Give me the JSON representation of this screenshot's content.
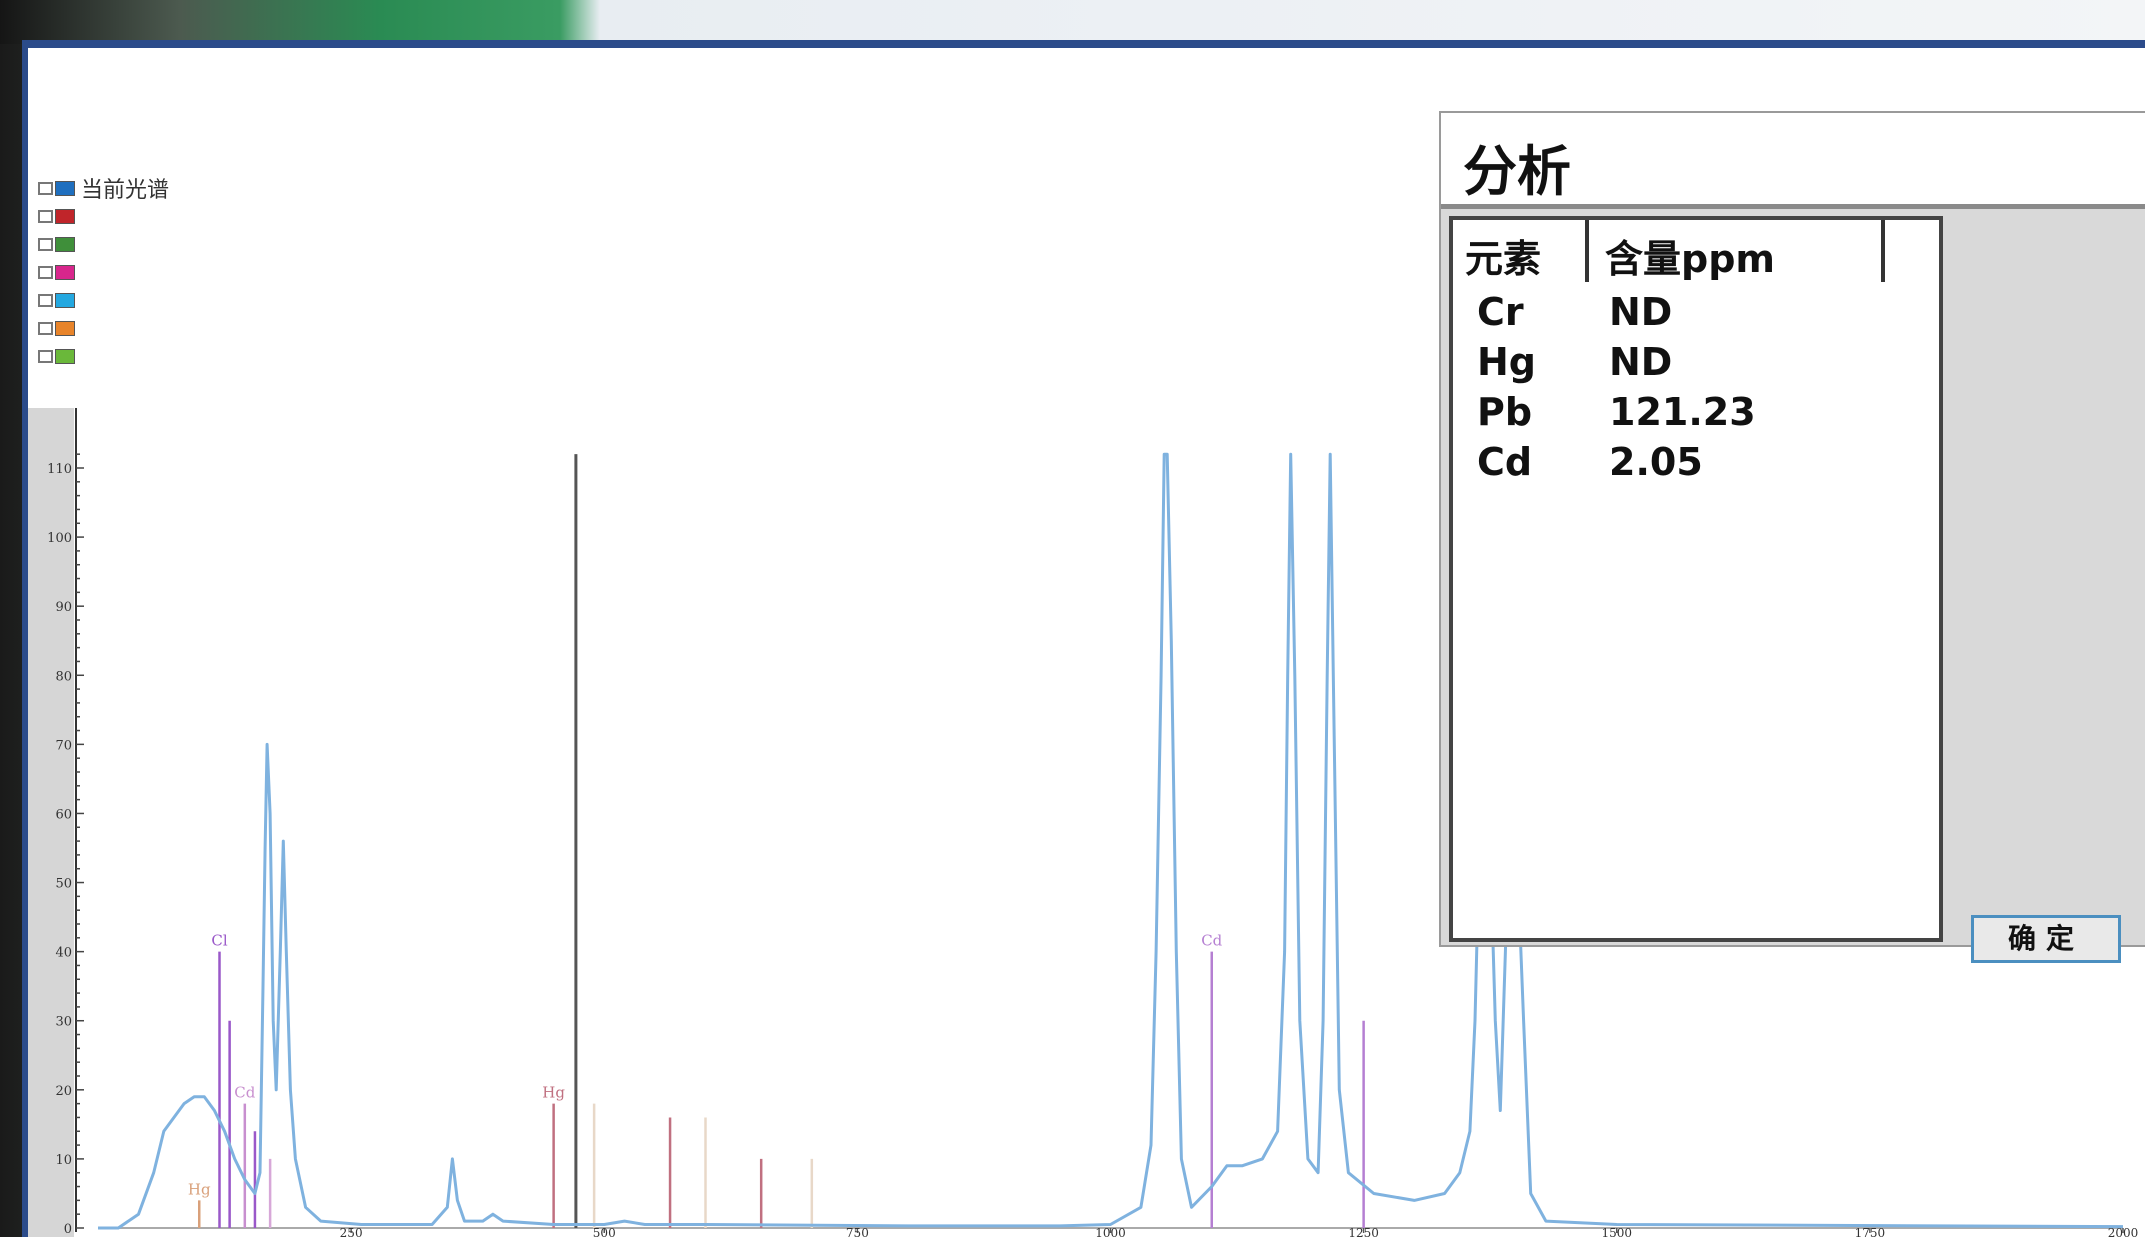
{
  "legend": {
    "items": [
      {
        "label": "当前光谱",
        "color": "#1f6fbf"
      },
      {
        "label": "",
        "color": "#c0252a"
      },
      {
        "label": "",
        "color": "#3f8f3a"
      },
      {
        "label": "",
        "color": "#d8268c"
      },
      {
        "label": "",
        "color": "#24a8e0"
      },
      {
        "label": "",
        "color": "#e8842a"
      },
      {
        "label": "",
        "color": "#6ab83a"
      }
    ]
  },
  "analysis": {
    "title": "分析",
    "col_element": "元素",
    "col_content": "含量ppm",
    "rows": [
      {
        "element": "Cr",
        "value": "ND"
      },
      {
        "element": "Hg",
        "value": "ND"
      },
      {
        "element": "Pb",
        "value": "121.23"
      },
      {
        "element": "Cd",
        "value": "2.05"
      }
    ],
    "confirm_label": "确定"
  },
  "chart_data": {
    "type": "line",
    "x_ticks": [
      "250",
      "500",
      "750",
      "1000",
      "1250",
      "1500",
      "1750",
      "2000"
    ],
    "y_ticks": [
      "0",
      "10",
      "20",
      "30",
      "40",
      "50",
      "60",
      "70",
      "80",
      "90",
      "100",
      "110"
    ],
    "xlim": [
      0,
      2000
    ],
    "ylim": [
      0,
      110
    ],
    "series": [
      {
        "color": "#7fb2df",
        "points": [
          [
            0,
            0
          ],
          [
            20,
            0
          ],
          [
            40,
            2
          ],
          [
            55,
            8
          ],
          [
            65,
            14
          ],
          [
            75,
            16
          ],
          [
            85,
            18
          ],
          [
            95,
            19
          ],
          [
            105,
            19
          ],
          [
            115,
            17
          ],
          [
            125,
            14
          ],
          [
            135,
            10
          ],
          [
            145,
            7
          ],
          [
            155,
            5
          ],
          [
            160,
            8
          ],
          [
            163,
            35
          ],
          [
            165,
            55
          ],
          [
            167,
            70
          ],
          [
            170,
            60
          ],
          [
            173,
            30
          ],
          [
            176,
            20
          ],
          [
            180,
            40
          ],
          [
            183,
            56
          ],
          [
            186,
            40
          ],
          [
            190,
            20
          ],
          [
            195,
            10
          ],
          [
            205,
            3
          ],
          [
            220,
            1
          ],
          [
            260,
            0.5
          ],
          [
            330,
            0.5
          ],
          [
            345,
            3
          ],
          [
            350,
            10
          ],
          [
            355,
            4
          ],
          [
            362,
            1
          ],
          [
            380,
            1
          ],
          [
            390,
            2
          ],
          [
            400,
            1
          ],
          [
            450,
            0.5
          ],
          [
            500,
            0.5
          ],
          [
            520,
            1
          ],
          [
            540,
            0.5
          ],
          [
            600,
            0.5
          ],
          [
            800,
            0.3
          ],
          [
            950,
            0.3
          ],
          [
            1000,
            0.5
          ],
          [
            1030,
            3
          ],
          [
            1040,
            12
          ],
          [
            1045,
            40
          ],
          [
            1050,
            80
          ],
          [
            1053,
            112
          ],
          [
            1056,
            112
          ],
          [
            1060,
            85
          ],
          [
            1065,
            40
          ],
          [
            1070,
            10
          ],
          [
            1080,
            3
          ],
          [
            1100,
            6
          ],
          [
            1115,
            9
          ],
          [
            1130,
            9
          ],
          [
            1150,
            10
          ],
          [
            1165,
            14
          ],
          [
            1172,
            40
          ],
          [
            1175,
            80
          ],
          [
            1178,
            112
          ],
          [
            1182,
            80
          ],
          [
            1187,
            30
          ],
          [
            1195,
            10
          ],
          [
            1205,
            8
          ],
          [
            1210,
            30
          ],
          [
            1214,
            80
          ],
          [
            1217,
            112
          ],
          [
            1220,
            80
          ],
          [
            1226,
            20
          ],
          [
            1235,
            8
          ],
          [
            1260,
            5
          ],
          [
            1300,
            4
          ],
          [
            1330,
            5
          ],
          [
            1345,
            8
          ],
          [
            1355,
            14
          ],
          [
            1360,
            30
          ],
          [
            1365,
            60
          ],
          [
            1370,
            70
          ],
          [
            1375,
            55
          ],
          [
            1380,
            30
          ],
          [
            1385,
            17
          ],
          [
            1390,
            40
          ],
          [
            1395,
            65
          ],
          [
            1400,
            60
          ],
          [
            1408,
            30
          ],
          [
            1415,
            5
          ],
          [
            1430,
            1
          ],
          [
            1500,
            0.5
          ],
          [
            2000,
            0.2
          ]
        ]
      }
    ],
    "markers": [
      {
        "x": 472,
        "height": 112,
        "color": "#555555"
      },
      {
        "x": 120,
        "height": 40,
        "color": "#9a58c9",
        "label": "Cl"
      },
      {
        "x": 130,
        "height": 30,
        "color": "#9a58c9"
      },
      {
        "x": 145,
        "height": 18,
        "color": "#c88fcf",
        "label": "Cd"
      },
      {
        "x": 155,
        "height": 14,
        "color": "#9a58c9"
      },
      {
        "x": 170,
        "height": 10,
        "color": "#d7a7d8"
      },
      {
        "x": 100,
        "height": 4,
        "color": "#d9a07a",
        "label": "Hg"
      },
      {
        "x": 450,
        "height": 18,
        "color": "#c07080",
        "label": "Hg"
      },
      {
        "x": 490,
        "height": 18,
        "color": "#e8d8c8"
      },
      {
        "x": 565,
        "height": 16,
        "color": "#c07080"
      },
      {
        "x": 600,
        "height": 16,
        "color": "#e8d8c8"
      },
      {
        "x": 655,
        "height": 10,
        "color": "#c07080"
      },
      {
        "x": 705,
        "height": 10,
        "color": "#e8d8c8"
      },
      {
        "x": 1100,
        "height": 40,
        "color": "#b57fd2",
        "label": "Cd"
      },
      {
        "x": 1250,
        "height": 30,
        "color": "#b57fd2"
      }
    ]
  }
}
